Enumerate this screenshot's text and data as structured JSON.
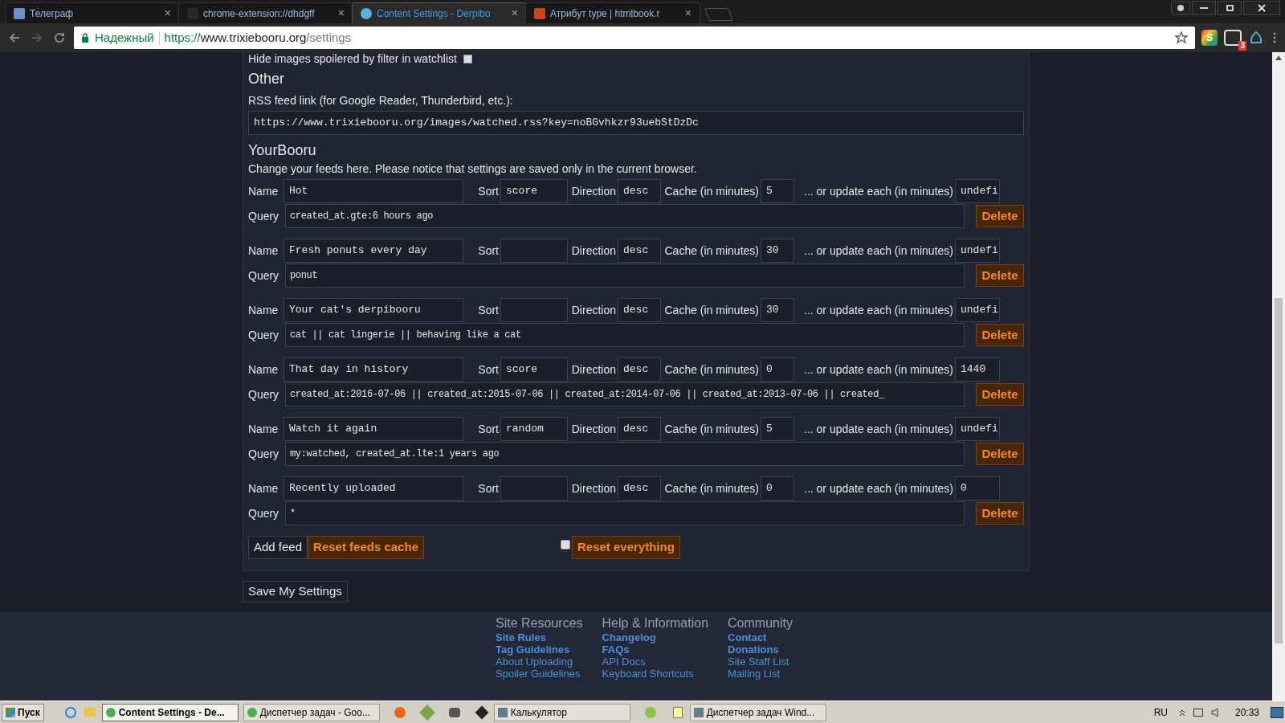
{
  "browser": {
    "tabs": [
      {
        "title": "Телеграф",
        "close": "×",
        "selected": false
      },
      {
        "title": "chrome-extension://dhdgff",
        "close": "×",
        "selected": false
      },
      {
        "title": "Content Settings - Derpibo",
        "close": "×",
        "selected": true
      },
      {
        "title": "Атрибут type | htmlbook.r",
        "close": "×",
        "selected": false
      }
    ],
    "address": {
      "secure_label": "Надежный",
      "scheme": "https://",
      "host": "www.trixiebooru.org",
      "path": "/settings"
    },
    "extension_badge": "3",
    "extension_letter": "S"
  },
  "page": {
    "watchlist_option": {
      "label": "Hide images spoilered by filter in watchlist",
      "checked": false
    },
    "other": {
      "heading": "Other",
      "rss_label": "RSS feed link (for Google Reader, Thunderbird, etc.):",
      "rss_url": "https://www.trixiebooru.org/images/watched.rss?key=noBGvhkzr93uebStDzDc"
    },
    "yourbooru": {
      "heading": "YourBooru",
      "note": "Change your feeds here. Please notice that settings are saved only in the current browser.",
      "feeds": [
        {
          "fields": [
            {
              "label": "Name",
              "value": "Hot"
            },
            {
              "label": "Sort",
              "value": "score"
            },
            {
              "label": "Direction",
              "value": "desc"
            },
            {
              "label": "Cache (in minutes)",
              "value": "5"
            },
            {
              "label": "... or update each (in minutes)",
              "value": "undefi"
            }
          ],
          "query": {
            "label": "Query",
            "value": "created_at.gte:6 hours ago"
          },
          "delete": "Delete"
        },
        {
          "fields": [
            {
              "label": "Name",
              "value": "Fresh ponuts every day"
            },
            {
              "label": "Sort"
            },
            {
              "label": "Direction",
              "value": "desc"
            },
            {
              "label": "Cache (in minutes)",
              "value": "30"
            },
            {
              "label": "... or update each (in minutes)",
              "value": "undefi"
            }
          ],
          "query": {
            "label": "Query",
            "value": "ponut"
          },
          "delete": "Delete"
        },
        {
          "fields": [
            {
              "label": "Name",
              "value": "Your cat's derpibooru"
            },
            {
              "label": "Sort"
            },
            {
              "label": "Direction",
              "value": "desc"
            },
            {
              "label": "Cache (in minutes)",
              "value": "30"
            },
            {
              "label": "... or update each (in minutes)",
              "value": "undefi"
            }
          ],
          "query": {
            "label": "Query",
            "value": "cat || cat lingerie || behaving like a cat"
          },
          "delete": "Delete"
        },
        {
          "fields": [
            {
              "label": "Name",
              "value": "That day in history"
            },
            {
              "label": "Sort",
              "value": "score"
            },
            {
              "label": "Direction",
              "value": "desc"
            },
            {
              "label": "Cache (in minutes)",
              "value": "0"
            },
            {
              "label": "... or update each (in minutes)",
              "value": "1440"
            }
          ],
          "query": {
            "label": "Query",
            "value": "created_at:2016-07-06 || created_at:2015-07-06 || created_at:2014-07-06 || created_at:2013-07-06 || created_"
          },
          "delete": "Delete"
        },
        {
          "fields": [
            {
              "label": "Name",
              "value": "Watch it again"
            },
            {
              "label": "Sort",
              "value": "random"
            },
            {
              "label": "Direction",
              "value": "desc"
            },
            {
              "label": "Cache (in minutes)",
              "value": "5"
            },
            {
              "label": "... or update each (in minutes)",
              "value": "undefi"
            }
          ],
          "query": {
            "label": "Query",
            "value": "my:watched, created_at.lte:1 years ago"
          },
          "delete": "Delete"
        },
        {
          "fields": [
            {
              "label": "Name",
              "value": "Recently uploaded"
            },
            {
              "label": "Sort"
            },
            {
              "label": "Direction",
              "value": "desc"
            },
            {
              "label": "Cache (in minutes)",
              "value": "0"
            },
            {
              "label": "... or update each (in minutes)",
              "value": "0"
            }
          ],
          "query": {
            "label": "Query",
            "value": "*"
          },
          "delete": "Delete"
        }
      ],
      "add_feed": "Add feed",
      "reset_cache": "Reset feeds cache",
      "reset_everything": {
        "label": "Reset everything",
        "checked": false
      }
    },
    "save": "Save My Settings"
  },
  "footer": {
    "columns": [
      {
        "heading": "Site Resources",
        "links": [
          {
            "text": "Site Rules",
            "bold": true
          },
          {
            "text": "Tag Guidelines",
            "bold": true
          },
          {
            "text": "About Uploading",
            "bold": false
          },
          {
            "text": "Spoiler Guidelines",
            "bold": false
          }
        ]
      },
      {
        "heading": "Help & Information",
        "links": [
          {
            "text": "Changelog",
            "bold": true
          },
          {
            "text": "FAQs",
            "bold": true
          },
          {
            "text": "API Docs",
            "bold": false
          },
          {
            "text": "Keyboard Shortcuts",
            "bold": false
          }
        ]
      },
      {
        "heading": "Community",
        "links": [
          {
            "text": "Contact",
            "bold": true
          },
          {
            "text": "Donations",
            "bold": true
          },
          {
            "text": "Site Staff List",
            "bold": false
          },
          {
            "text": "Mailing List",
            "bold": false
          }
        ]
      }
    ]
  },
  "taskbar": {
    "start": "Пуск",
    "tasks": [
      {
        "title": "Content Settings - De...",
        "selected": true
      },
      {
        "title": "Диспетчер задач - Goo...",
        "selected": false
      },
      {
        "title": "Калькулятор",
        "selected": false
      },
      {
        "title": "Диспетчер задач Wind...",
        "selected": false
      }
    ],
    "language": "RU",
    "clock": "20:33"
  }
}
